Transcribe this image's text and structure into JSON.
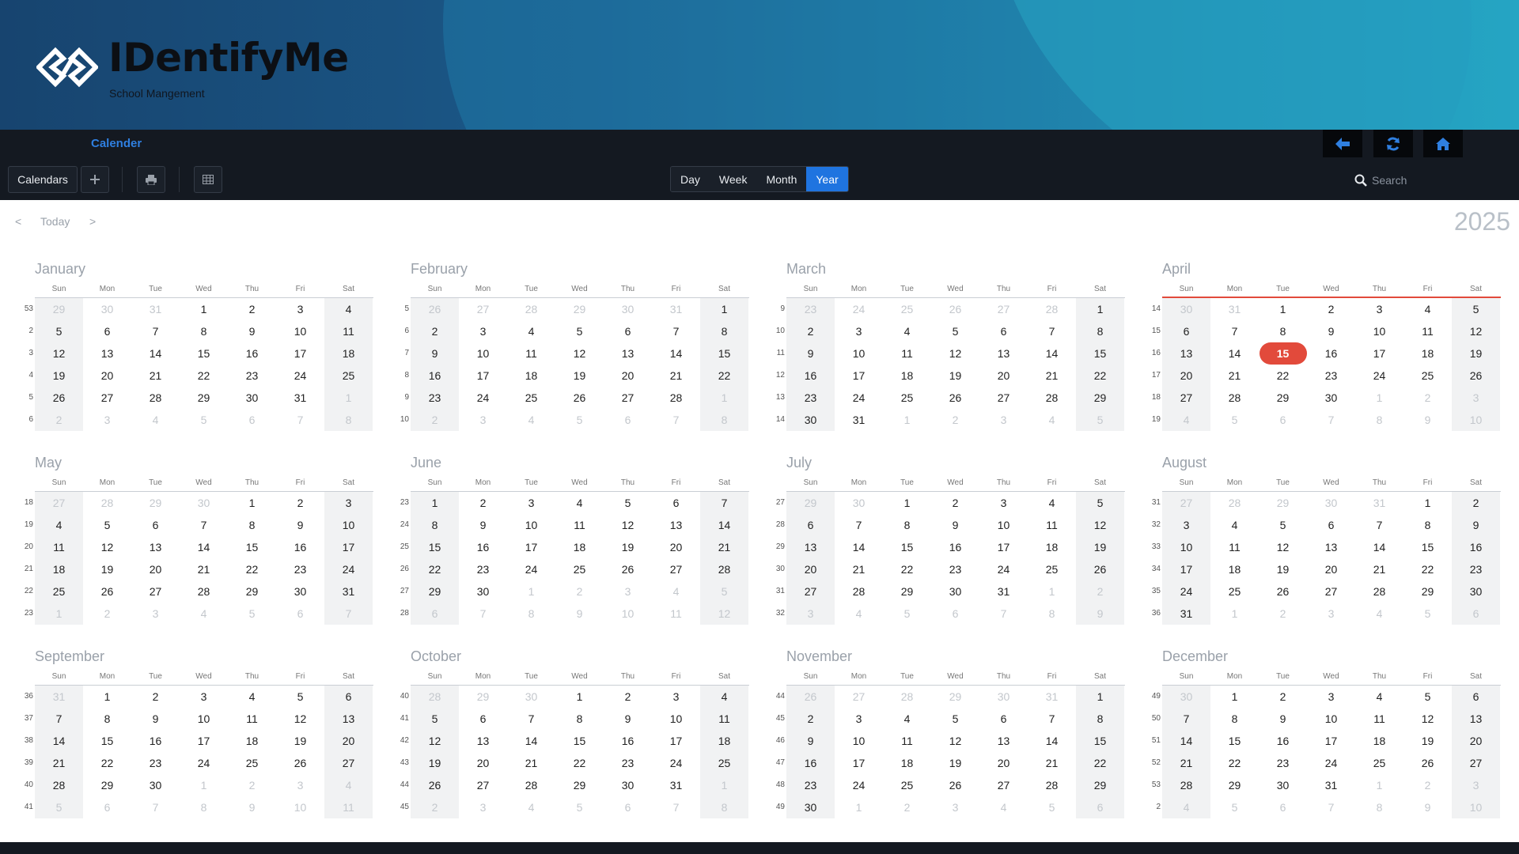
{
  "brand": {
    "title": "IDentifyMe",
    "subtitle": "School Mangement"
  },
  "header": {
    "page_link": "Calender",
    "nav_buttons": [
      {
        "name": "back-button",
        "icon": "arrow-left-icon"
      },
      {
        "name": "refresh-button",
        "icon": "refresh-icon"
      },
      {
        "name": "home-button",
        "icon": "home-icon"
      }
    ],
    "accent_color": "#2f7fe0"
  },
  "toolbar": {
    "calendars_label": "Calendars",
    "add_icon": "plus-icon",
    "print_icon": "printer-icon",
    "grid_icon": "grid-icon",
    "views": [
      "Day",
      "Week",
      "Month",
      "Year"
    ],
    "active_view": "Year",
    "search_placeholder": "Search"
  },
  "nav": {
    "prev": "<",
    "today": "Today",
    "next": ">"
  },
  "year": "2025",
  "today": {
    "month_index": 3,
    "day": 15,
    "color": "#e24a3b"
  },
  "weekdays": [
    "Sun",
    "Mon",
    "Tue",
    "Wed",
    "Thu",
    "Fri",
    "Sat"
  ],
  "months": [
    {
      "name": "January",
      "week_numbers": [
        53,
        2,
        3,
        4,
        5,
        6
      ]
    },
    {
      "name": "February",
      "week_numbers": [
        5,
        6,
        7,
        8,
        9,
        10
      ]
    },
    {
      "name": "March",
      "week_numbers": [
        9,
        10,
        11,
        12,
        13,
        14
      ]
    },
    {
      "name": "April",
      "week_numbers": [
        14,
        15,
        16,
        17,
        18,
        19
      ]
    },
    {
      "name": "May",
      "week_numbers": [
        18,
        19,
        20,
        21,
        22,
        23
      ]
    },
    {
      "name": "June",
      "week_numbers": [
        23,
        24,
        25,
        26,
        27,
        28
      ]
    },
    {
      "name": "July",
      "week_numbers": [
        27,
        28,
        29,
        30,
        31,
        32
      ]
    },
    {
      "name": "August",
      "week_numbers": [
        31,
        32,
        33,
        34,
        35,
        36
      ]
    },
    {
      "name": "September",
      "week_numbers": [
        36,
        37,
        38,
        39,
        40,
        41
      ]
    },
    {
      "name": "October",
      "week_numbers": [
        40,
        41,
        42,
        43,
        44,
        45
      ]
    },
    {
      "name": "November",
      "week_numbers": [
        44,
        45,
        46,
        47,
        48,
        49
      ]
    },
    {
      "name": "December",
      "week_numbers": [
        49,
        50,
        51,
        52,
        53,
        2
      ]
    }
  ]
}
